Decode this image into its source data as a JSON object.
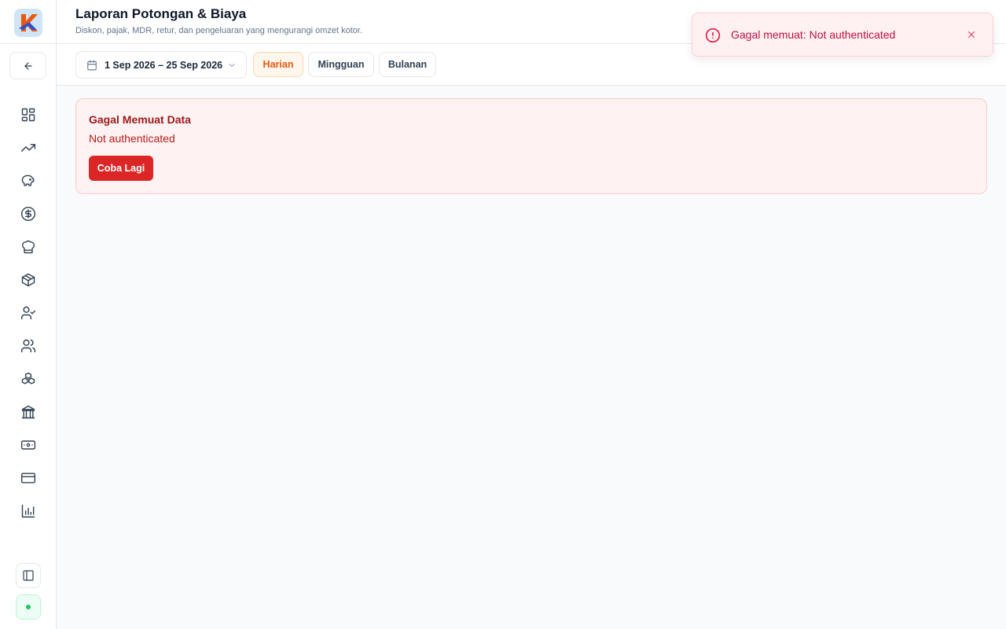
{
  "app": {
    "logo_icon": "k-logo-icon",
    "brand_colors": {
      "accent": "#ea580c",
      "danger": "#dc2626",
      "success": "#22c55e"
    }
  },
  "header": {
    "title": "Laporan Potongan & Biaya",
    "subtitle": "Diskon, pajak, MDR, retur, dan pengeluaran yang mengurangi omzet kotor."
  },
  "sidebar": {
    "back_icon": "arrow-left-icon",
    "items": [
      {
        "icon": "dashboard-icon"
      },
      {
        "icon": "trending-up-icon"
      },
      {
        "icon": "piggy-bank-icon"
      },
      {
        "icon": "dollar-circle-icon"
      },
      {
        "icon": "chef-hat-icon"
      },
      {
        "icon": "package-icon"
      },
      {
        "icon": "user-check-icon"
      },
      {
        "icon": "users-icon"
      },
      {
        "icon": "boxes-icon"
      },
      {
        "icon": "bank-icon"
      },
      {
        "icon": "banknote-icon"
      },
      {
        "icon": "credit-card-icon"
      },
      {
        "icon": "bar-chart-icon"
      }
    ],
    "collapse_icon": "sidebar-panel-icon",
    "status_icon": "online-status-dot"
  },
  "toolbar": {
    "date_range": "1 Sep 2026 – 25 Sep 2026",
    "periods": [
      {
        "label": "Harian",
        "active": true
      },
      {
        "label": "Mingguan",
        "active": false
      },
      {
        "label": "Bulanan",
        "active": false
      }
    ]
  },
  "error": {
    "title": "Gagal Memuat Data",
    "message": "Not authenticated",
    "retry_label": "Coba Lagi"
  },
  "toast": {
    "message": "Gagal memuat: Not authenticated",
    "icon": "alert-circle-icon",
    "close_icon": "close-icon"
  }
}
